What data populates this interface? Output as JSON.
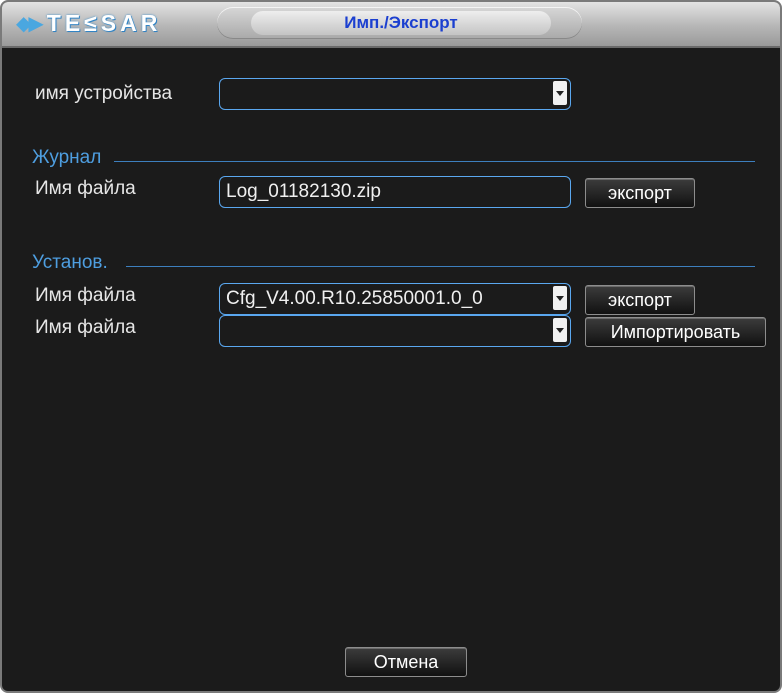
{
  "window": {
    "brand": "TE≤SAR",
    "title": "Имп./Экспорт"
  },
  "device": {
    "label": "имя устройства",
    "value": ""
  },
  "journal": {
    "section_title": "Журнал",
    "file_label": "Имя файла",
    "file_value": "Log_01182130.zip",
    "export_label": "экспорт"
  },
  "settings": {
    "section_title": "Установ.",
    "export_file_label": "Имя файла",
    "export_file_value": "Cfg_V4.00.R10.25850001.0_0",
    "export_label": "экспорт",
    "import_file_label": "Имя файла",
    "import_file_value": "",
    "import_label": "Импортировать"
  },
  "footer": {
    "cancel_label": "Отмена"
  },
  "colors": {
    "background": "#1b1b1b",
    "accent": "#4e9ee0",
    "title_text": "#1b3fd0"
  }
}
